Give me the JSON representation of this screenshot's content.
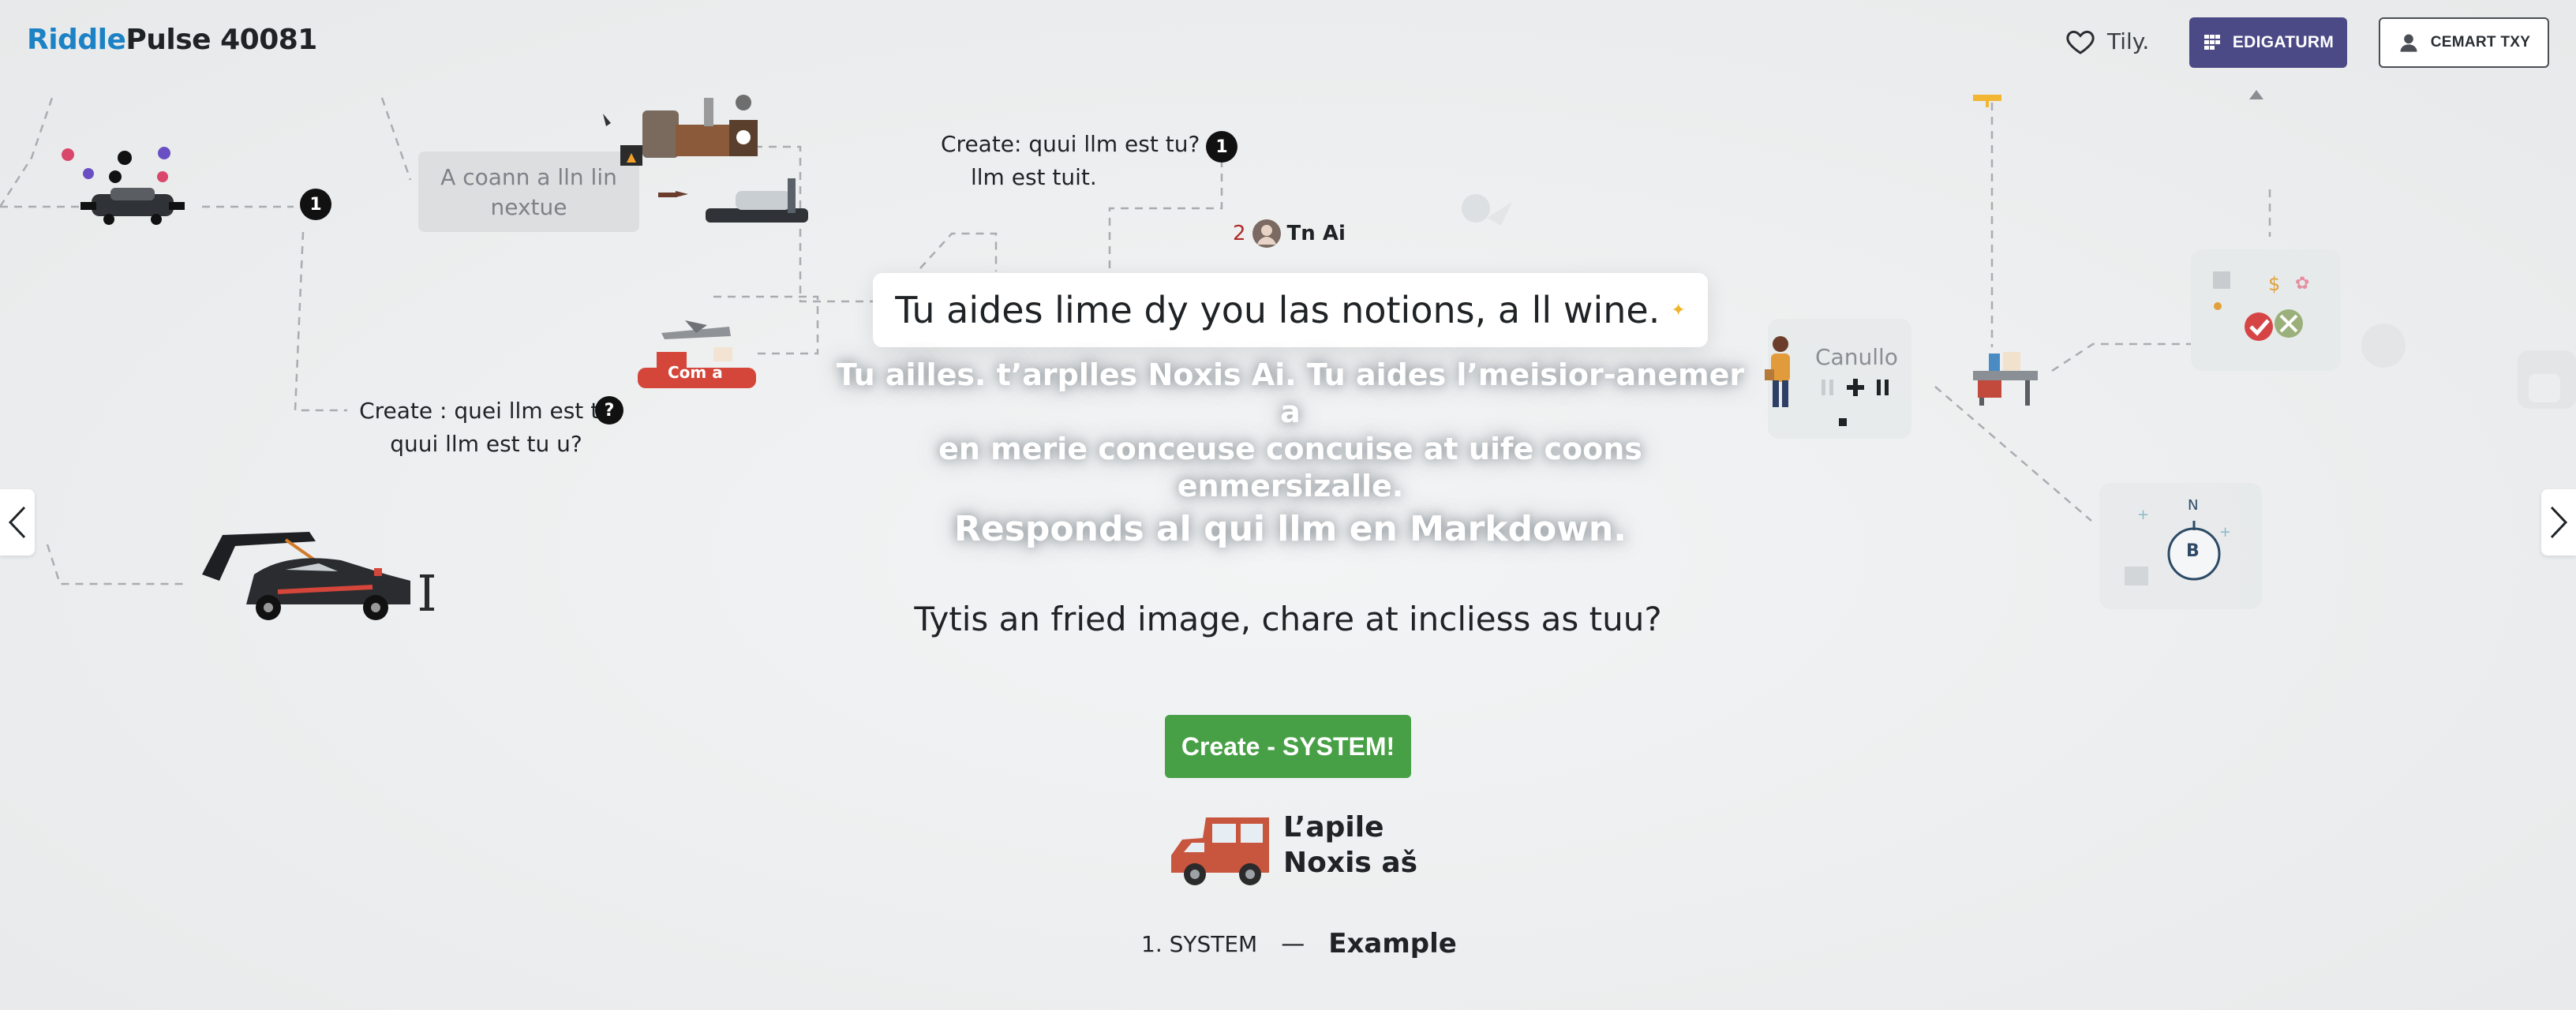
{
  "header": {
    "logo_part1": "Riddle",
    "logo_part2": "Pulse 40081",
    "favorite_label": "Tily.",
    "primary_button": "EDIGATURM",
    "secondary_button": "CEMART TXY"
  },
  "diagram": {
    "badge_1": "1",
    "badge_2": "1",
    "badge_help": "?",
    "gray_box_text": "A coann a lln lin nextue",
    "node_top_line1": "Create: quui llm est tu?",
    "node_top_line2": "llm est tuit.",
    "node_left_line1": "Create : quei llm est tu",
    "node_left_line2": "quui llm est tu u?",
    "persona_number": "2",
    "persona_name": "Tn Ai",
    "ship_label": "Com a",
    "worker_label": "Canullo",
    "target_letter": "B",
    "target_north": "N"
  },
  "main": {
    "hero_prompt": "Tu aides lime dy you las notions, a ll wine.",
    "system_line1": "Tu ailles. t’arplles Noxis Ai. Tu aides l’meisior-anemer a",
    "system_line2": "en merie conceuse concuise at uife coons enmersizalle.",
    "system_line3": "Responds al qui llm en Markdown.",
    "question": "Tytis an fried image, chare at incliess as tuu?",
    "cta_button": "Create - SYSTEM!",
    "car_label_line1": "L’apile",
    "car_label_line2": "Noxis aš"
  },
  "footer": {
    "step": "1. SYSTEM",
    "separator": "—",
    "example": "Example"
  },
  "colors": {
    "brand_blue": "#1c82c6",
    "primary_purple": "#4c4a86",
    "cta_green": "#48a046",
    "background": "#eceeef"
  }
}
